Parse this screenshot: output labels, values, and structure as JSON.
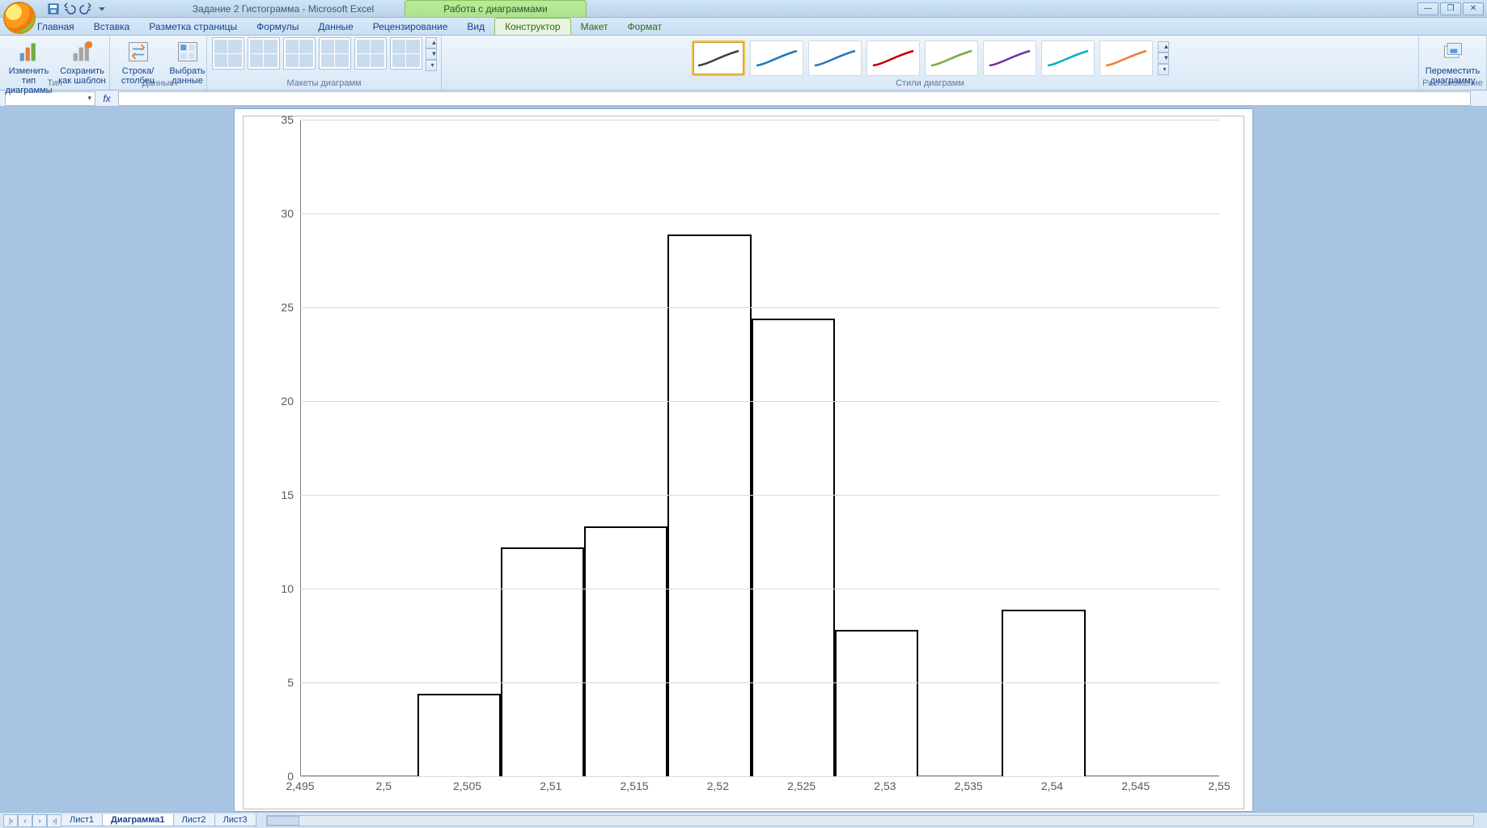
{
  "title": {
    "document": "Задание 2 Гистограмма - Microsoft Excel",
    "tools_context": "Работа с диаграммами"
  },
  "qat_icons": [
    "save-icon",
    "undo-icon",
    "redo-icon",
    "customize-icon"
  ],
  "win_controls": [
    "minimize",
    "restore",
    "close"
  ],
  "tabs": {
    "standard": [
      "Главная",
      "Вставка",
      "Разметка страницы",
      "Формулы",
      "Данные",
      "Рецензирование",
      "Вид"
    ],
    "context": [
      "Конструктор",
      "Макет",
      "Формат"
    ],
    "active": "Конструктор"
  },
  "ribbon": {
    "group_type": {
      "label": "Тип",
      "btn_change": "Изменить тип\nдиаграммы",
      "btn_template": "Сохранить\nкак шаблон"
    },
    "group_data": {
      "label": "Данные",
      "btn_switch": "Строка/столбец",
      "btn_select": "Выбрать\nданные"
    },
    "group_layouts": {
      "label": "Макеты диаграмм"
    },
    "group_styles": {
      "label": "Стили диаграмм",
      "colors": [
        "#404040",
        "#1f77b4",
        "#2e75b6",
        "#c00000",
        "#70ad47",
        "#7030a0",
        "#00b0c6",
        "#ed7d31"
      ],
      "selected": 0
    },
    "group_loc": {
      "label": "Расположение",
      "btn_move": "Переместить\nдиаграмму"
    }
  },
  "formula_bar": {
    "name": "",
    "fx": "fx",
    "formula": ""
  },
  "sheets": {
    "nav": [
      "|‹",
      "‹",
      "›",
      "›|"
    ],
    "tabs": [
      "Лист1",
      "Диаграмма1",
      "Лист2",
      "Лист3"
    ],
    "active": "Диаграмма1"
  },
  "chart_data": {
    "type": "bar",
    "title": "",
    "xlabel": "",
    "ylabel": "",
    "xlim": [
      2.495,
      2.55
    ],
    "ylim": [
      0,
      35
    ],
    "xticks": [
      2.495,
      2.5,
      2.505,
      2.51,
      2.515,
      2.52,
      2.525,
      2.53,
      2.535,
      2.54,
      2.545,
      2.55
    ],
    "xtick_labels": [
      "2,495",
      "2,5",
      "2,505",
      "2,51",
      "2,515",
      "2,52",
      "2,525",
      "2,53",
      "2,535",
      "2,54",
      "2,545",
      "2,55"
    ],
    "yticks": [
      0,
      5,
      10,
      15,
      20,
      25,
      30,
      35
    ],
    "bars": [
      {
        "x0": 2.502,
        "x1": 2.507,
        "y": 4.4
      },
      {
        "x0": 2.507,
        "x1": 2.512,
        "y": 12.2
      },
      {
        "x0": 2.512,
        "x1": 2.517,
        "y": 13.3
      },
      {
        "x0": 2.517,
        "x1": 2.522,
        "y": 28.9
      },
      {
        "x0": 2.522,
        "x1": 2.527,
        "y": 24.4
      },
      {
        "x0": 2.527,
        "x1": 2.532,
        "y": 7.8
      },
      {
        "x0": 2.537,
        "x1": 2.542,
        "y": 8.9
      }
    ]
  }
}
